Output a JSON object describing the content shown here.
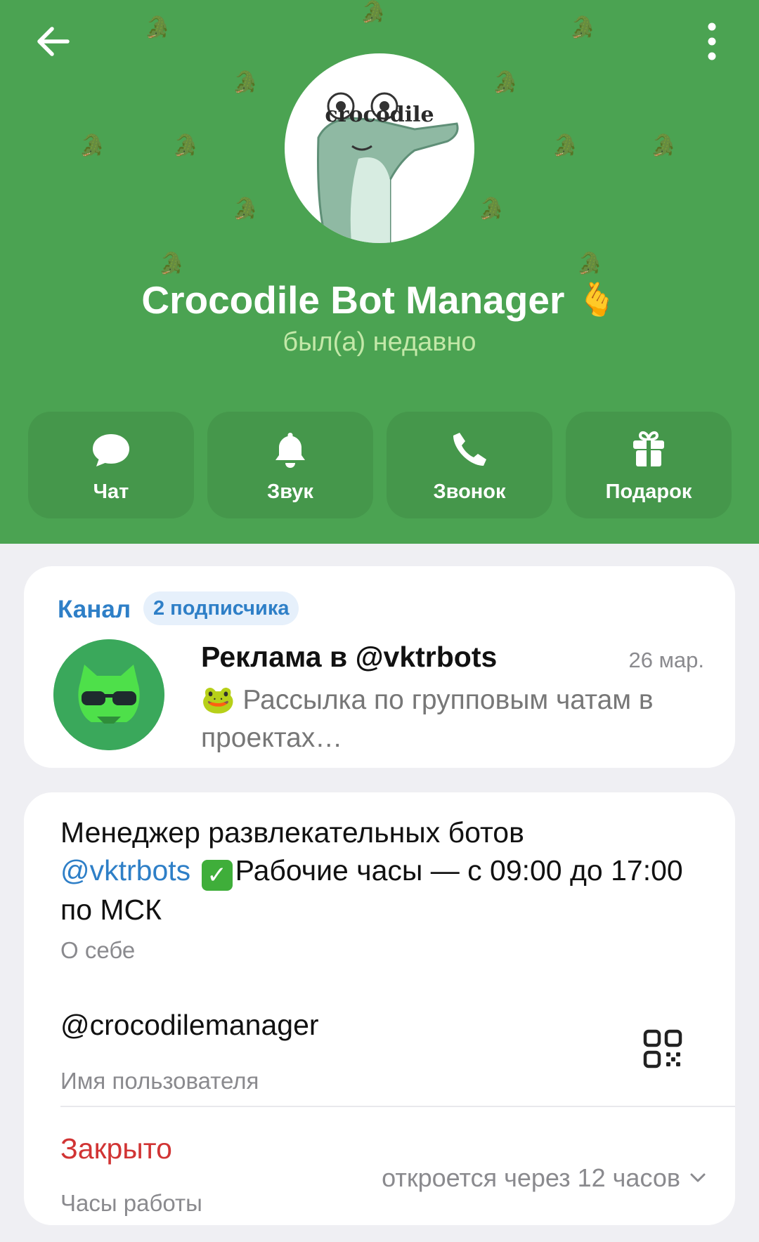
{
  "header": {
    "avatar_text": "crocodile",
    "name": "Crocodile Bot Manager",
    "name_emoji": "🫰",
    "status": "был(а) недавно",
    "actions": [
      {
        "label": "Чат",
        "icon": "chat-icon"
      },
      {
        "label": "Звук",
        "icon": "bell-icon"
      },
      {
        "label": "Звонок",
        "icon": "phone-icon"
      },
      {
        "label": "Подарок",
        "icon": "gift-icon"
      }
    ]
  },
  "channel": {
    "title": "Канал",
    "subscribers": "2 подписчика",
    "post_title": "Реклама в @vktrbots",
    "post_date": "26 мар.",
    "post_emoji": "🐸",
    "post_text": "Рассылка по групповым чатам в проектах…"
  },
  "info": {
    "bio_line1": "Менеджер развлекательных ботов",
    "bio_link": "@vktrbots",
    "bio_check": "✓",
    "bio_rest": "Рабочие часы — с 09:00 до 17:00 по МСК",
    "bio_caption": "О себе",
    "username": "@crocodilemanager",
    "username_caption": "Имя пользователя",
    "hours_status": "Закрыто",
    "hours_caption": "Часы работы",
    "opens_in": "откроется через 12 часов"
  },
  "colors": {
    "header_bg": "#4ba352",
    "link": "#2e7fc7",
    "closed": "#d13434"
  }
}
